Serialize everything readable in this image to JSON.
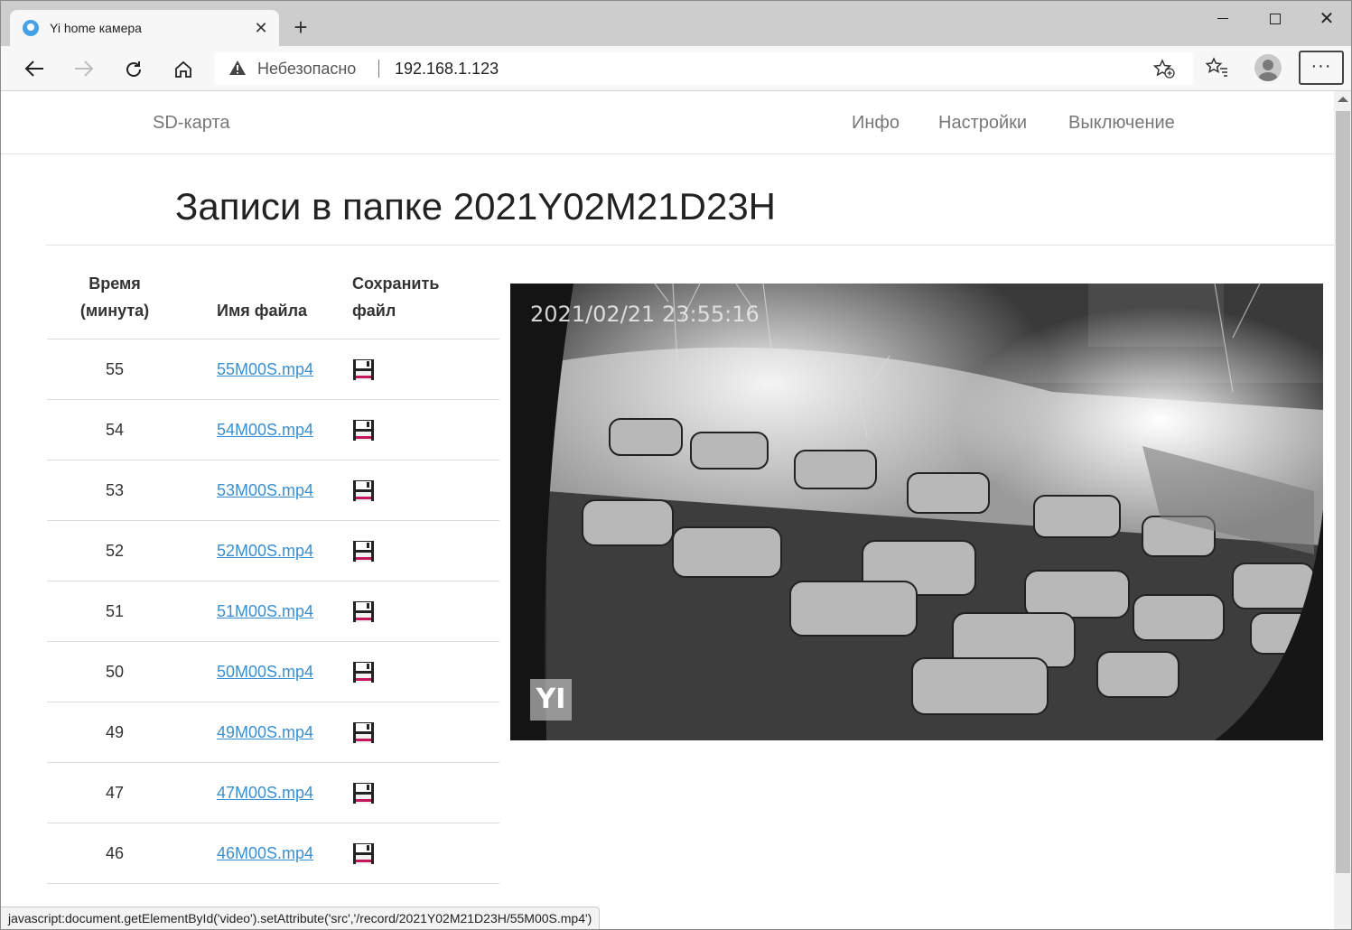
{
  "browser": {
    "tab_title": "Yi home камера",
    "tab_close": "✕",
    "new_tab": "+",
    "window_close": "✕",
    "insecure_label": "Небезопасно",
    "url": "192.168.1.123",
    "menu": "···"
  },
  "site": {
    "brand": "SD-карта",
    "nav": {
      "info": "Инфо",
      "settings": "Настройки",
      "shutdown": "Выключение"
    },
    "title": "Записи в папке 2021Y02M21D23H"
  },
  "table": {
    "headers": {
      "minute": [
        "Время",
        "(минута)"
      ],
      "file": "Имя файла",
      "save": [
        "Сохранить",
        "файл"
      ]
    },
    "rows": [
      {
        "minute": "55",
        "file": "55M00S.mp4"
      },
      {
        "minute": "54",
        "file": "54M00S.mp4"
      },
      {
        "minute": "53",
        "file": "53M00S.mp4"
      },
      {
        "minute": "52",
        "file": "52M00S.mp4"
      },
      {
        "minute": "51",
        "file": "51M00S.mp4"
      },
      {
        "minute": "50",
        "file": "50M00S.mp4"
      },
      {
        "minute": "49",
        "file": "49M00S.mp4"
      },
      {
        "minute": "47",
        "file": "47M00S.mp4"
      },
      {
        "minute": "46",
        "file": "46M00S.mp4"
      }
    ]
  },
  "video": {
    "timestamp": "2021/02/21  23:55:16",
    "logo": "YI"
  },
  "status_bar": "javascript:document.getElementById('video').setAttribute('src','/record/2021Y02M21D23H/55M00S.mp4')",
  "colors": {
    "link": "#3a8fd0",
    "save_icon_accent": "#c2185b"
  }
}
